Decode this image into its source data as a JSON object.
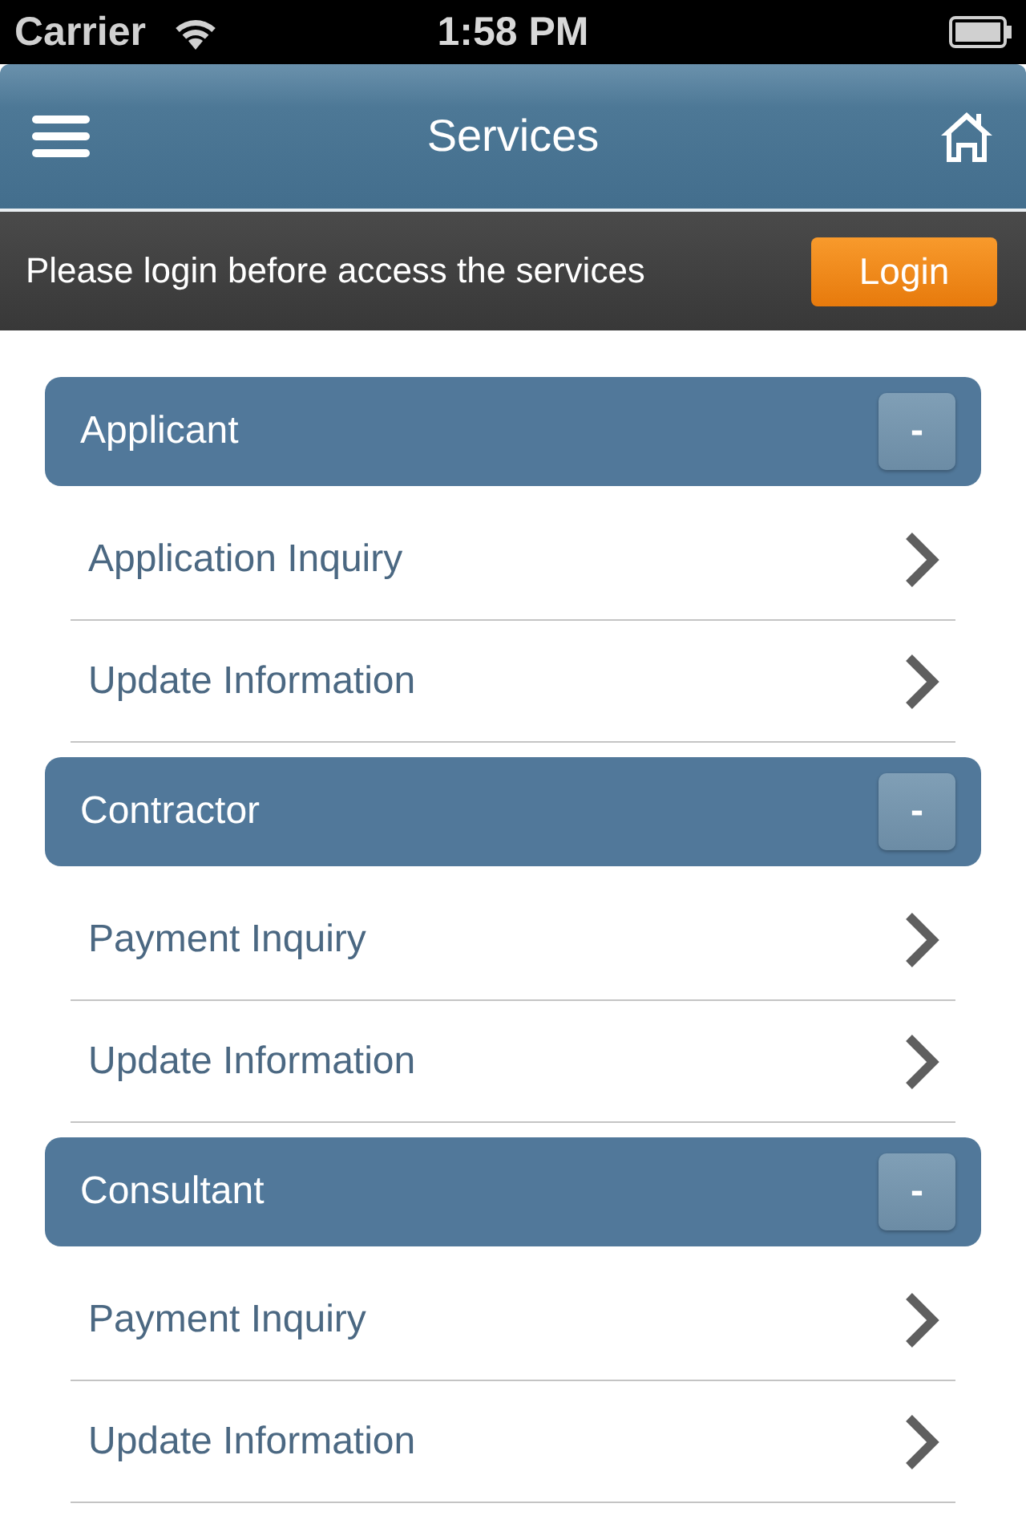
{
  "status_bar": {
    "carrier": "Carrier",
    "time": "1:58 PM"
  },
  "nav_bar": {
    "title": "Services"
  },
  "login_banner": {
    "message": "Please login before access the services",
    "button": "Login"
  },
  "sections": [
    {
      "title": "Applicant",
      "toggle": "-",
      "items": [
        {
          "label": "Application Inquiry"
        },
        {
          "label": "Update Information"
        }
      ]
    },
    {
      "title": "Contractor",
      "toggle": "-",
      "items": [
        {
          "label": "Payment Inquiry"
        },
        {
          "label": "Update Information"
        }
      ]
    },
    {
      "title": "Consultant",
      "toggle": "-",
      "items": [
        {
          "label": "Payment Inquiry"
        },
        {
          "label": "Update Information"
        }
      ]
    }
  ]
}
